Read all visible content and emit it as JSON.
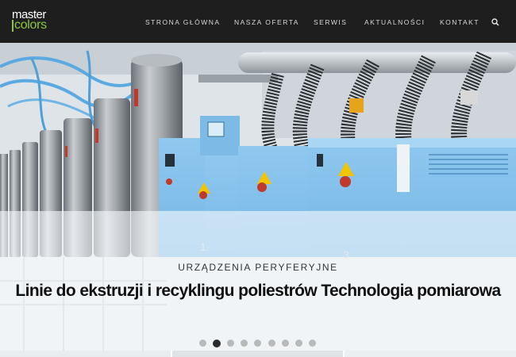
{
  "brand": {
    "logo_top": "master",
    "logo_bottom": "colors",
    "accent": "#8cc63f",
    "nav_bg": "#1e1e1e"
  },
  "nav": {
    "items": [
      {
        "label": "STRONA GŁÓWNA"
      },
      {
        "label": "NASZA OFERTA"
      },
      {
        "label": "SERWIS"
      },
      {
        "label": "AKTUALNOŚCI"
      },
      {
        "label": "KONTAKT"
      }
    ],
    "search_icon": "search-icon"
  },
  "slider": {
    "subtitle": "URZĄDZENIA PERYFERYJNE",
    "headline": "Linie do ekstruzji i recyklingu poliestrów Technologia pomiarowa",
    "dot_count": 9,
    "active_dot": 2
  }
}
